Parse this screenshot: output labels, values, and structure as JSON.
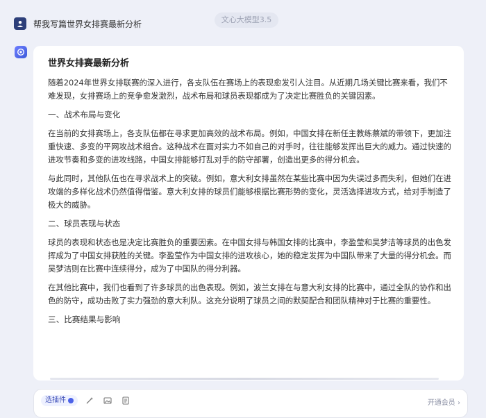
{
  "header": {
    "model_label": "文心大模型3.5"
  },
  "user_message": {
    "text": "帮我写篇世界女排赛最新分析"
  },
  "answer": {
    "title": "世界女排赛最新分析",
    "intro": "随着2024年世界女排联赛的深入进行，各支队伍在赛场上的表现愈发引人注目。从近期几场关键比赛来看，我们不难发现，女排赛场上的竞争愈发激烈，战术布局和球员表现都成为了决定比赛胜负的关键因素。",
    "section1_heading": "一、战术布局与变化",
    "section1_p1": "在当前的女排赛场上，各支队伍都在寻求更加高效的战术布局。例如，中国女排在新任主教练蔡斌的带领下，更加注重快速、多变的平网攻战术组合。这种战术在面对实力不如自己的对手时，往往能够发挥出巨大的威力。通过快速的进攻节奏和多变的进攻线路，中国女排能够打乱对手的防守部署，创造出更多的得分机会。",
    "section1_p2": "与此同时，其他队伍也在寻求战术上的突破。例如，意大利女排虽然在某些比赛中因为失误过多而失利，但她们在进攻端的多样化战术仍然值得借鉴。意大利女排的球员们能够根据比赛形势的变化，灵活选择进攻方式，给对手制造了极大的威胁。",
    "section2_heading": "二、球员表现与状态",
    "section2_p1": "球员的表现和状态也是决定比赛胜负的重要因素。在中国女排与韩国女排的比赛中，李盈莹和吴梦洁等球员的出色发挥成为了中国女排获胜的关键。李盈莹作为中国女排的进攻核心，她的稳定发挥为中国队带来了大量的得分机会。而吴梦洁则在比赛中连续得分，成为了中国队的得分利器。",
    "section2_p2": "在其他比赛中，我们也看到了许多球员的出色表现。例如，波兰女排在与意大利女排的比赛中，通过全队的协作和出色的防守，成功击败了实力强劲的意大利队。这充分说明了球员之间的默契配合和团队精神对于比赛的重要性。",
    "section3_heading": "三、比赛结果与影响"
  },
  "composer": {
    "plugin_label": "选插件",
    "upgrade_label": "开通会员 ›"
  },
  "colors": {
    "accent": "#4c62e8",
    "page_bg": "#eef0f8",
    "card_bg": "#ffffff"
  },
  "icons": [
    "user-avatar-icon",
    "ernie-bot-icon",
    "magic-wand-icon",
    "image-icon",
    "document-icon"
  ]
}
